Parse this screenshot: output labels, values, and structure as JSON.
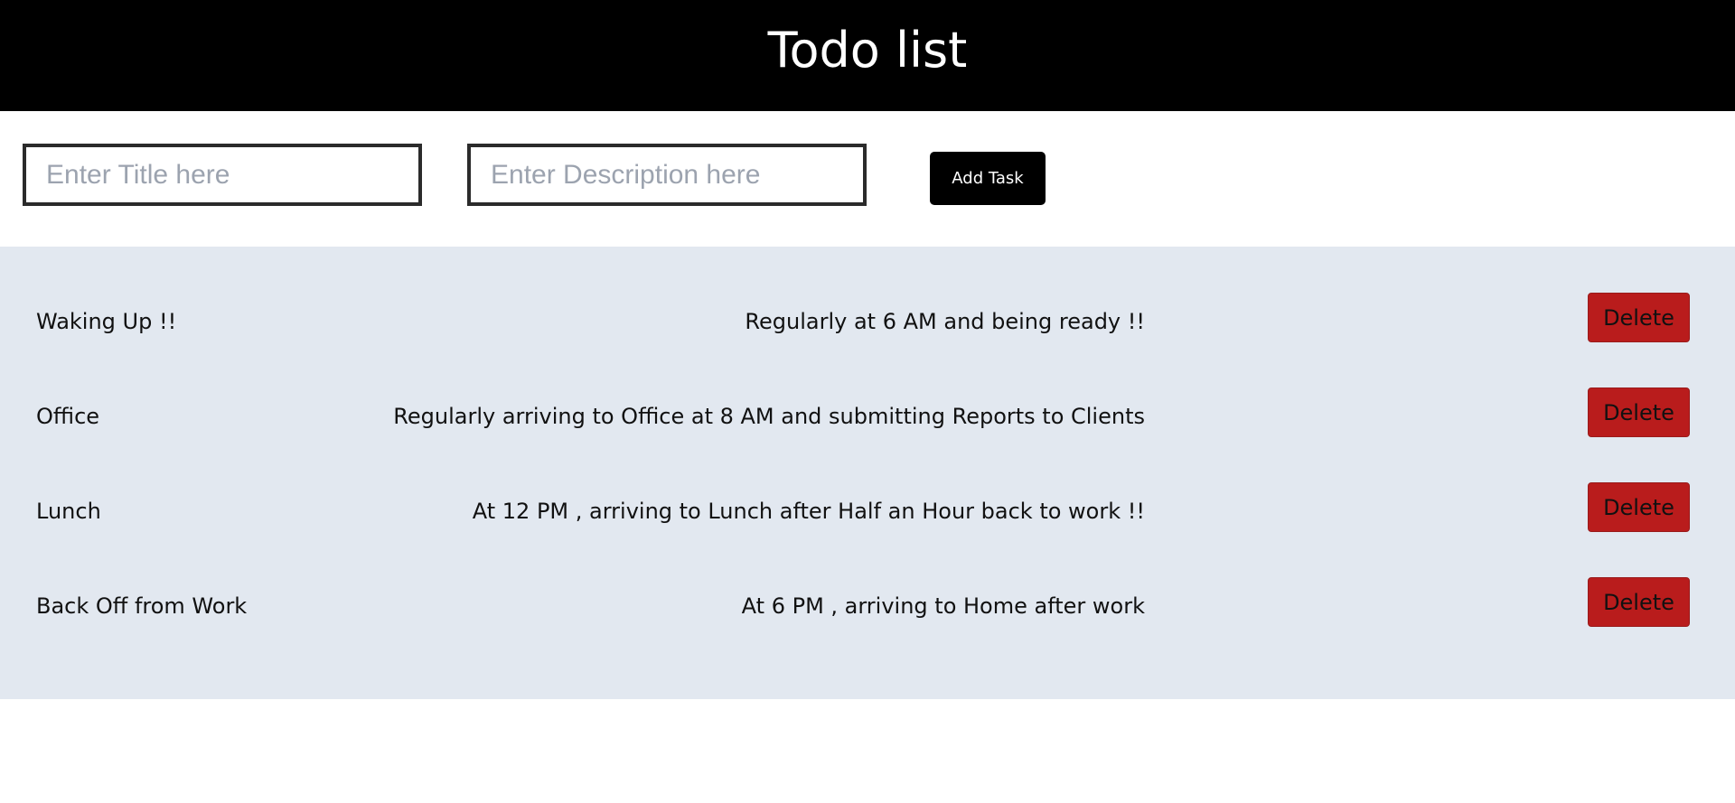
{
  "header": {
    "title": "Todo list"
  },
  "form": {
    "title_placeholder": "Enter Title here",
    "title_value": "",
    "description_placeholder": "Enter Description here",
    "description_value": "",
    "add_label": "Add Task"
  },
  "tasks": [
    {
      "title": "Waking Up !!",
      "description": "Regularly at 6 AM and being ready !!",
      "delete_label": "Delete"
    },
    {
      "title": "Office",
      "description": "Regularly arriving to Office at 8 AM and submitting Reports to Clients",
      "delete_label": "Delete"
    },
    {
      "title": "Lunch",
      "description": "At 12 PM , arriving to Lunch after Half an Hour back to work !!",
      "delete_label": "Delete"
    },
    {
      "title": "Back Off from Work",
      "description": "At 6 PM , arriving to Home after work",
      "delete_label": "Delete"
    }
  ],
  "colors": {
    "header_bg": "#000000",
    "panel_bg": "#e2e8f0",
    "delete_bg": "#b91c1c",
    "add_bg": "#000000"
  }
}
